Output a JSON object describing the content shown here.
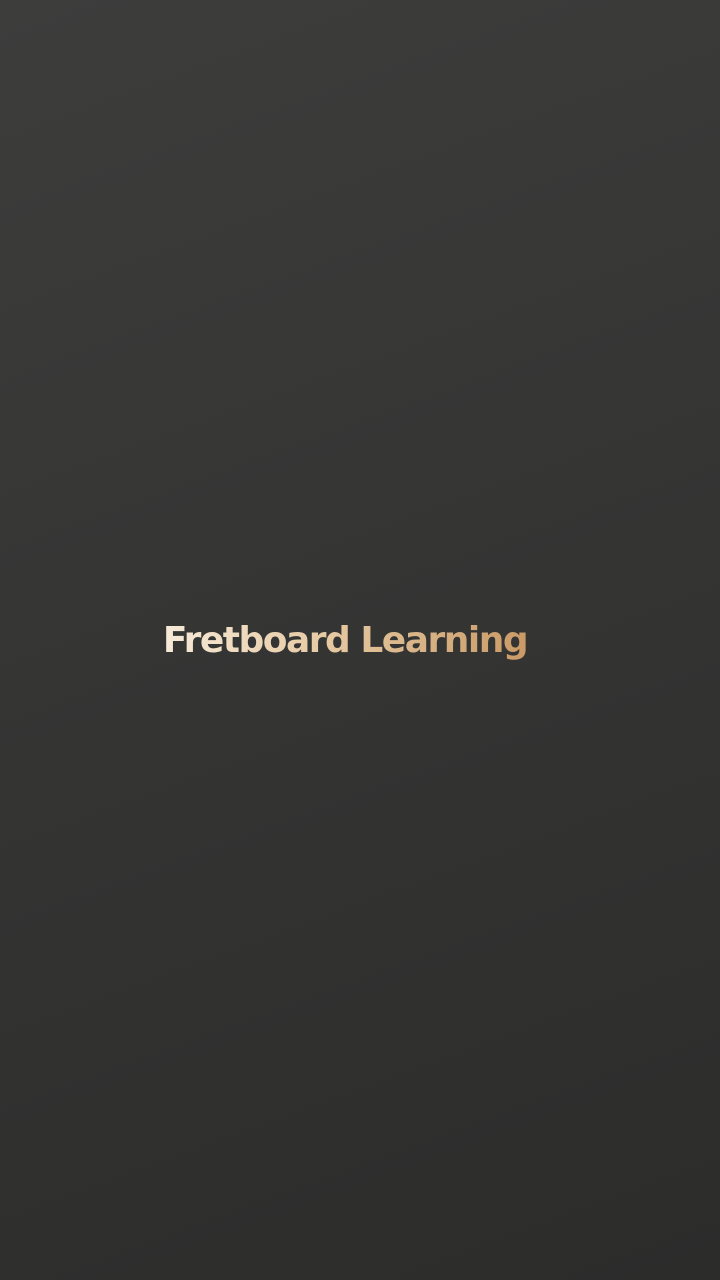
{
  "app": {
    "logo_text": "Fretboard Learning"
  },
  "theme": {
    "background_top": "#3d3d3c",
    "background_bottom": "#2c2c2b",
    "logo_gradient_start": "#f6ead8",
    "logo_gradient_end": "#c99a66"
  }
}
